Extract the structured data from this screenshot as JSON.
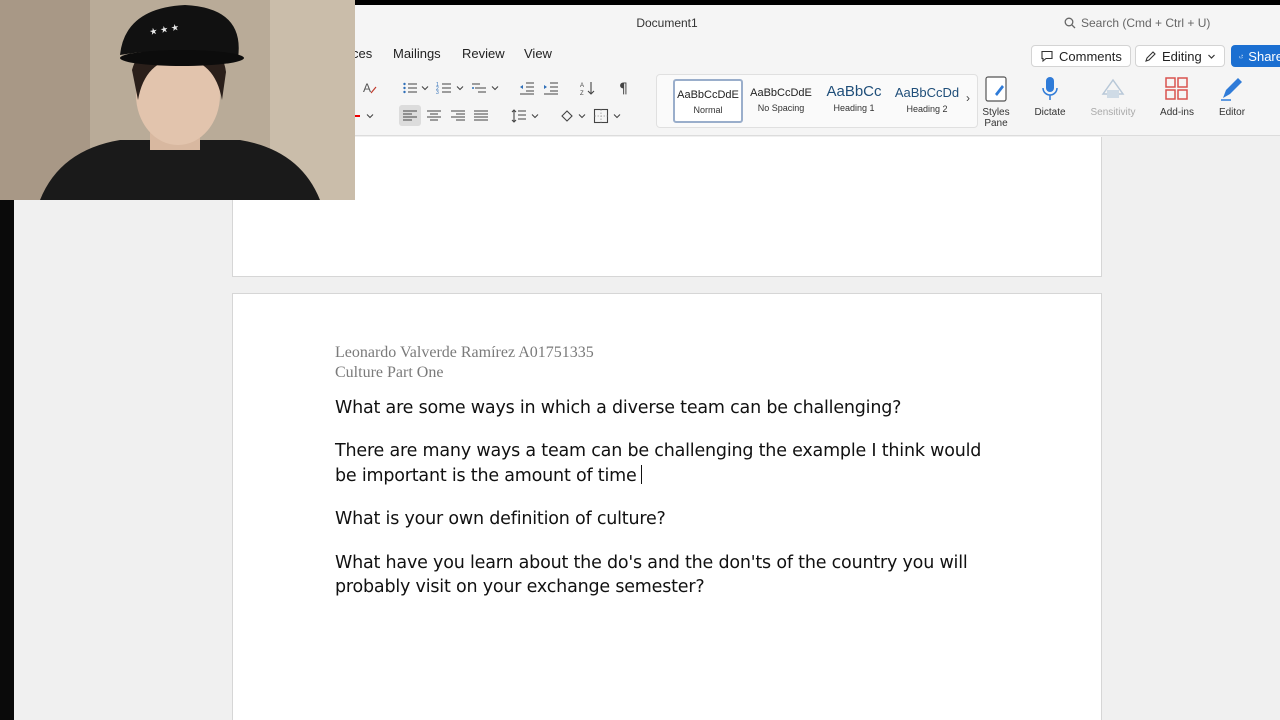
{
  "window": {
    "title": "Document1"
  },
  "search": {
    "label": "Search (Cmd + Ctrl + U)"
  },
  "tabs": [
    {
      "label": "ces"
    },
    {
      "label": "Mailings"
    },
    {
      "label": "Review"
    },
    {
      "label": "View"
    }
  ],
  "actions": {
    "comments": "Comments",
    "editing": "Editing",
    "share": "Share"
  },
  "styles": [
    {
      "sample": "AaBbCcDdE",
      "name": "Normal",
      "selected": true
    },
    {
      "sample": "AaBbCcDdE",
      "name": "No Spacing",
      "selected": false
    },
    {
      "sample": "AaBbCc",
      "name": "Heading 1",
      "selected": false
    },
    {
      "sample": "AaBbCcDd",
      "name": "Heading 2",
      "selected": false
    }
  ],
  "ribbon_buttons": {
    "styles_pane": "Styles Pane",
    "dictate": "Dictate",
    "sensitivity": "Sensitivity",
    "add_ins": "Add-ins",
    "editor": "Editor"
  },
  "document": {
    "header_name": "Leonardo Valverde Ramírez A01751335",
    "header_subtitle": "Culture Part One",
    "q1": "What are some ways in which a diverse team can be challenging?",
    "a1_line1": "There are many ways a team can be challenging the example I think would",
    "a1_line2": "be important is the amount of time",
    "q2": "What is your own definition of culture?",
    "q3_line1": "What have you learn about the do's and the don'ts of the country you will",
    "q3_line2": "probably visit on your exchange semester?"
  },
  "colors": {
    "share_blue": "#1b6fd1",
    "dictate_blue": "#2f7bd8",
    "addins_red": "#d9534f"
  }
}
